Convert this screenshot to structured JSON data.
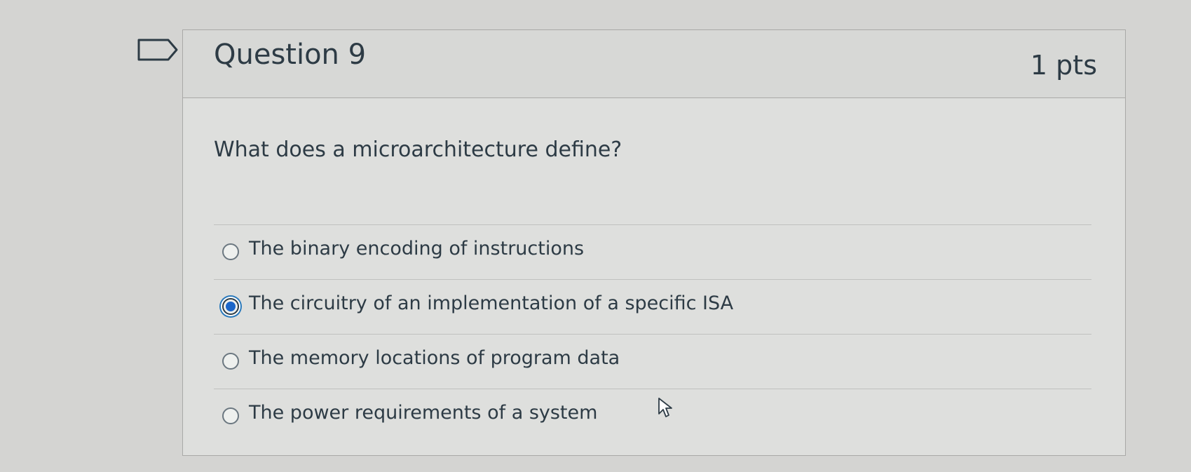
{
  "question": {
    "title": "Question 9",
    "points": "1 pts",
    "text": "What does a microarchitecture define?",
    "answers": [
      {
        "label": "The binary encoding of instructions",
        "selected": false
      },
      {
        "label": "The circuitry of an implementation of a specific ISA",
        "selected": true
      },
      {
        "label": "The memory locations of program data",
        "selected": false
      },
      {
        "label": "The power requirements of a system",
        "selected": false
      }
    ]
  },
  "icons": {
    "flag": "flag-icon",
    "cursor": "cursor-arrow-icon"
  },
  "colors": {
    "selected_radio": "#1b66c9",
    "text": "#2d3b45"
  }
}
